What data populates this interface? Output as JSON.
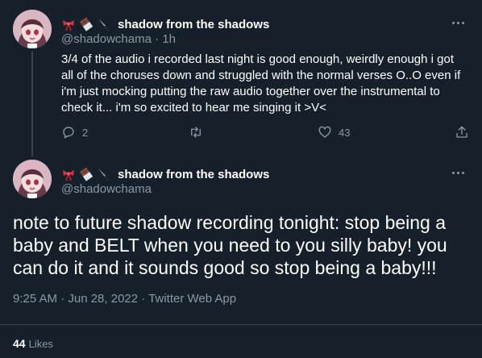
{
  "colors": {
    "background": "#15202b",
    "text": "#ffffff",
    "muted": "#8b98a5",
    "border": "#38444d"
  },
  "tweet1": {
    "name_emojis": [
      "ribbon-icon",
      "chocolate-icon",
      "knife-icon"
    ],
    "display_name": "shadow from the shadows",
    "handle": "@shadowchama",
    "time": "· 1h",
    "text": "3/4 of the audio i recorded last night is good enough, weirdly enough i got all of the choruses down and struggled with the normal verses O..O even if i'm just mocking putting the raw audio together over the instrumental to check it... i'm so excited to hear me singing it >V<",
    "reply_count": "2",
    "retweet_count": "",
    "like_count": "43"
  },
  "tweet2": {
    "name_emojis": [
      "ribbon-icon",
      "chocolate-icon",
      "knife-icon"
    ],
    "display_name": "shadow from the shadows",
    "handle": "@shadowchama",
    "text": "note to future shadow recording tonight: stop being a baby and BELT when you need to you silly baby! you can do it and it sounds good so stop being a baby!!!",
    "meta": "9:25 AM · Jun 28, 2022 · Twitter Web App",
    "likes_count": "44",
    "likes_label": "Likes"
  }
}
